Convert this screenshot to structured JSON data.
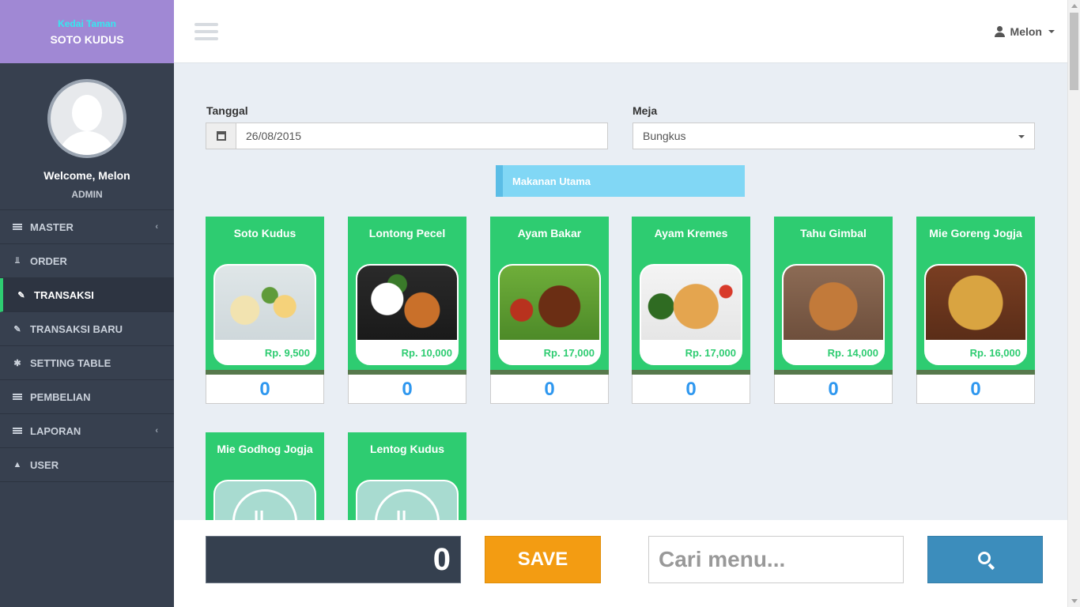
{
  "brand": {
    "line1": "Kedai Taman",
    "line2": "SOTO KUDUS"
  },
  "profile": {
    "welcome": "Welcome, Melon",
    "role": "ADMIN"
  },
  "nav": [
    {
      "label": "MASTER",
      "icon": "list-icon",
      "has_chevron": true
    },
    {
      "label": "ORDER",
      "icon": "cutlery-icon",
      "has_chevron": false
    },
    {
      "label": "TRANSAKSI",
      "icon": "edit-icon",
      "has_chevron": false,
      "active": true
    },
    {
      "label": "TRANSAKSI BARU",
      "icon": "edit-icon",
      "has_chevron": false
    },
    {
      "label": "SETTING TABLE",
      "icon": "asterisk-icon",
      "has_chevron": false
    },
    {
      "label": "PEMBELIAN",
      "icon": "list-icon",
      "has_chevron": false
    },
    {
      "label": "LAPORAN",
      "icon": "list-icon",
      "has_chevron": true
    },
    {
      "label": "USER",
      "icon": "user-icon",
      "has_chevron": false
    }
  ],
  "header": {
    "user_name": "Melon"
  },
  "form": {
    "date_label": "Tanggal",
    "date_value": "26/08/2015",
    "table_label": "Meja",
    "table_value": "Bungkus"
  },
  "category": "Makanan Utama",
  "menu": [
    {
      "name": "Soto Kudus",
      "price": "Rp. 9,500",
      "qty": "0"
    },
    {
      "name": "Lontong Pecel",
      "price": "Rp. 10,000",
      "qty": "0"
    },
    {
      "name": "Ayam Bakar",
      "price": "Rp. 17,000",
      "qty": "0"
    },
    {
      "name": "Ayam Kremes",
      "price": "Rp. 17,000",
      "qty": "0"
    },
    {
      "name": "Tahu Gimbal",
      "price": "Rp. 14,000",
      "qty": "0"
    },
    {
      "name": "Mie Goreng Jogja",
      "price": "Rp. 16,000",
      "qty": "0"
    },
    {
      "name": "Mie Godhog Jogja"
    },
    {
      "name": "Lentog Kudus"
    }
  ],
  "footer": {
    "total": "0",
    "save_label": "SAVE",
    "search_placeholder": "Cari menu..."
  },
  "colors": {
    "brand_bg": "#a088d4",
    "sidebar_bg": "#37404f",
    "card_green": "#2ecc71",
    "save_orange": "#f39c12",
    "search_blue": "#3c8dbc",
    "qty_blue": "#2e97ef"
  }
}
